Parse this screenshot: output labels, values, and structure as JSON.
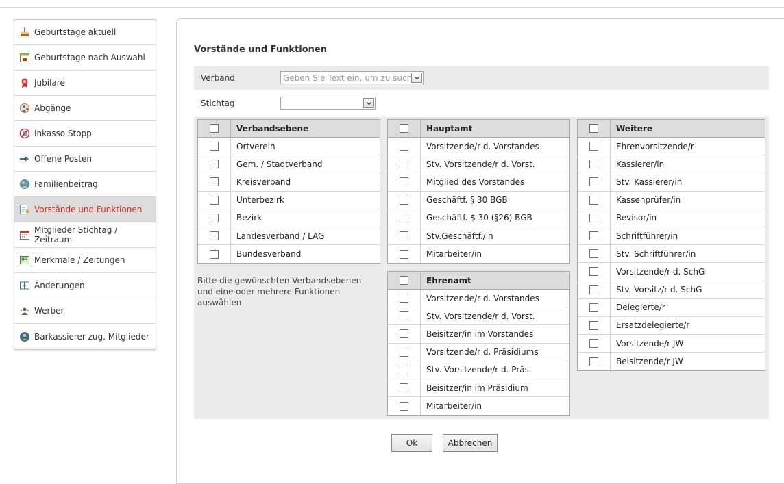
{
  "sidebar": {
    "items": [
      {
        "label": "Geburtstage aktuell",
        "icon": "cake-icon"
      },
      {
        "label": "Geburtstage nach Auswahl",
        "icon": "calendar-cake-icon"
      },
      {
        "label": "Jubilare",
        "icon": "ribbon-icon"
      },
      {
        "label": "Abgänge",
        "icon": "person-leave-icon"
      },
      {
        "label": "Inkasso Stopp",
        "icon": "stop-icon"
      },
      {
        "label": "Offene Posten",
        "icon": "arrow-right-icon"
      },
      {
        "label": "Familienbeitrag",
        "icon": "family-icon"
      },
      {
        "label": "Vorstände und Funktionen",
        "icon": "board-icon",
        "active": true
      },
      {
        "label": "Mitglieder Stichtag / Zeitraum",
        "icon": "calendar-icon"
      },
      {
        "label": "Merkmale / Zeitungen",
        "icon": "newspaper-icon"
      },
      {
        "label": "Änderungen",
        "icon": "changes-icon"
      },
      {
        "label": "Werber",
        "icon": "recruiter-icon"
      },
      {
        "label": "Barkassierer zug. Mitglieder",
        "icon": "cashier-icon"
      }
    ]
  },
  "main": {
    "title": "Vorstände und Funktionen",
    "verband": {
      "label": "Verband",
      "placeholder": "Geben Sie Text ein, um zu suchen"
    },
    "stichtag": {
      "label": "Stichtag",
      "value": ""
    },
    "hint_line1": "Bitte die gewünschten Verbandsebenen",
    "hint_line2": "und eine oder mehrere Funktionen auswählen",
    "tables": {
      "verbandsebene": {
        "header": "Verbandsebene",
        "rows": [
          "Ortverein",
          "Gem. / Stadtverband",
          "Kreisverband",
          "Unterbezirk",
          "Bezirk",
          "Landesverband / LAG",
          "Bundesverband"
        ]
      },
      "hauptamt": {
        "header": "Hauptamt",
        "rows": [
          "Vorsitzende/r d. Vorstandes",
          "Stv. Vorsitzende/r d. Vorst.",
          "Mitglied des Vorstandes",
          "Geschäftf. § 30 BGB",
          "Geschäftf. $ 30 (§26) BGB",
          "Stv.Geschäftf./in",
          "Mitarbeiter/in"
        ]
      },
      "ehrenamt": {
        "header": "Ehrenamt",
        "rows": [
          "Vorsitzende/r d. Vorstandes",
          "Stv. Vorsitzende/r d. Vorst.",
          "Beisitzer/in im Vorstandes",
          "Vorsitzende/r d. Präsidiums",
          "Stv. Vorsitzende/r d. Präs.",
          "Beisitzer/in im Präsidium",
          "Mitarbeiter/in"
        ]
      },
      "weitere": {
        "header": "Weitere",
        "rows": [
          "Ehrenvorsitzende/r",
          "Kassierer/in",
          "Stv. Kassierer/in",
          "Kassenprüfer/in",
          "Revisor/in",
          "Schriftführer/in",
          "Stv. Schriftführer/in",
          "Vorsitzende/r d. SchG",
          "Stv. Vorsitz/r d. SchG",
          "Delegierte/r",
          "Ersatzdelegierte/r",
          "Vorsitzende/r JW",
          "Beisitzende/r JW"
        ]
      }
    },
    "ok_label": "Ok",
    "cancel_label": "Abbrechen"
  }
}
